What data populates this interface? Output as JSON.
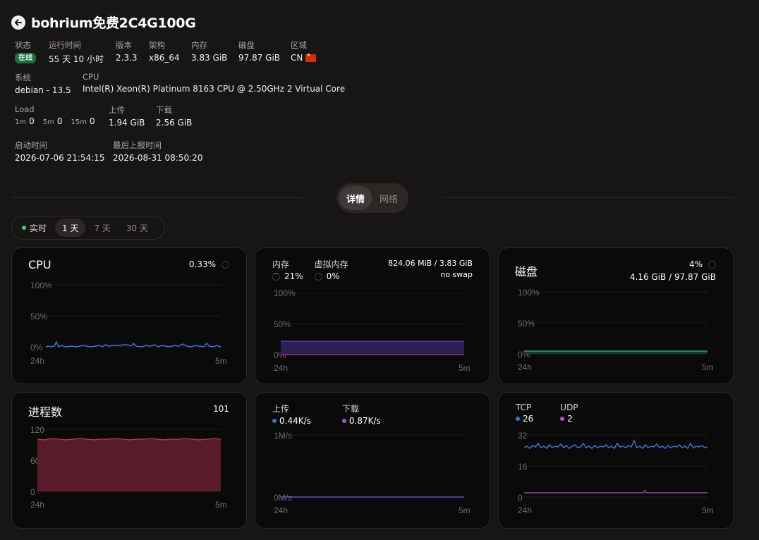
{
  "header": {
    "title": "bohrium免费2C4G100G"
  },
  "info": {
    "status_label": "状态",
    "status_value": "在线",
    "uptime_label": "运行时间",
    "uptime_value": "55 天 10 小时",
    "version_label": "版本",
    "version_value": "2.3.3",
    "arch_label": "架构",
    "arch_value": "x86_64",
    "mem_label": "内存",
    "mem_value": "3.83 GiB",
    "disk_label": "磁盘",
    "disk_value": "97.87 GiB",
    "region_label": "区域",
    "region_value": "CN",
    "system_label": "系统",
    "system_value": "debian - 13.5",
    "cpu_label": "CPU",
    "cpu_value": "Intel(R) Xeon(R) Platinum 8163 CPU @ 2.50GHz 2 Virtual Core",
    "load_label": "Load",
    "load_1m_k": "1m",
    "load_1m_v": "0",
    "load_5m_k": "5m",
    "load_5m_v": "0",
    "load_15m_k": "15m",
    "load_15m_v": "0",
    "upload_label": "上传",
    "upload_value": "1.94 GiB",
    "download_label": "下载",
    "download_value": "2.56 GiB",
    "boot_label": "启动时间",
    "boot_value": "2026-07-06 21:54:15",
    "report_label": "最后上报时间",
    "report_value": "2026-08-31 08:50:20"
  },
  "tabs": {
    "details": "详情",
    "network": "网络",
    "active": "details"
  },
  "range": {
    "live": "实时",
    "day1": "1 天",
    "day7": "7 天",
    "day30": "30 天",
    "active": "day1"
  },
  "colors": {
    "blue": "#3b74d8",
    "purple": "#7b3fd0",
    "green": "#1fa46a",
    "crimson": "#8c2338"
  },
  "cards": {
    "cpu": {
      "title": "CPU",
      "value": "0.33%",
      "y_ticks": [
        "100%",
        "50%",
        "0%"
      ],
      "x_start": "24h",
      "x_end": "5m"
    },
    "memory": {
      "mem_label": "内存",
      "mem_value": "21%",
      "swap_label": "虚拟内存",
      "swap_value": "0%",
      "detail_line1": "824.06 MiB / 3.83 GiB",
      "detail_line2": "no swap",
      "y_ticks": [
        "100%",
        "50%",
        "0%"
      ],
      "x_start": "24h",
      "x_end": "5m"
    },
    "disk": {
      "title": "磁盘",
      "value": "4%",
      "detail": "4.16 GiB / 97.87 GiB",
      "y_ticks": [
        "100%",
        "50%",
        "0%"
      ],
      "x_start": "24h",
      "x_end": "5m"
    },
    "process": {
      "title": "进程数",
      "value": "101",
      "y_ticks": [
        "120",
        "60",
        "0"
      ],
      "x_start": "24h",
      "x_end": "5m"
    },
    "network": {
      "up_label": "上传",
      "up_value": "0.44K/s",
      "down_label": "下载",
      "down_value": "0.87K/s",
      "y_ticks": [
        "1M/s",
        "0M/s"
      ],
      "x_start": "24h",
      "x_end": "5m"
    },
    "conn": {
      "tcp_label": "TCP",
      "tcp_value": "26",
      "udp_label": "UDP",
      "udp_value": "2",
      "y_ticks": [
        "32",
        "16",
        "0"
      ],
      "x_start": "24h",
      "x_end": "5m"
    }
  }
}
